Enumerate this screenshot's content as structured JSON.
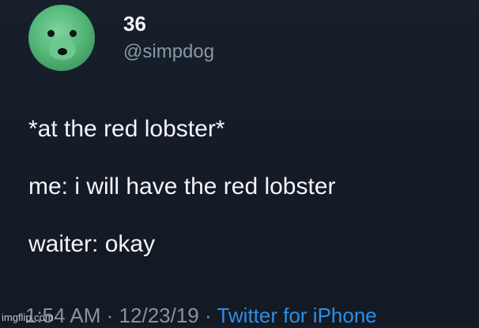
{
  "tweet": {
    "display_name": "36",
    "handle": "@simpdog",
    "lines": [
      "*at the red lobster*",
      "me: i will have the red lobster",
      "waiter: okay"
    ],
    "time": "1:54 AM",
    "separator": "·",
    "date": "12/23/19",
    "source": "Twitter for iPhone"
  },
  "watermark": "imgflip.com",
  "colors": {
    "background": "#151c27",
    "text": "#f3f5f8",
    "muted": "#8793a2",
    "link": "#2e8ee3"
  }
}
